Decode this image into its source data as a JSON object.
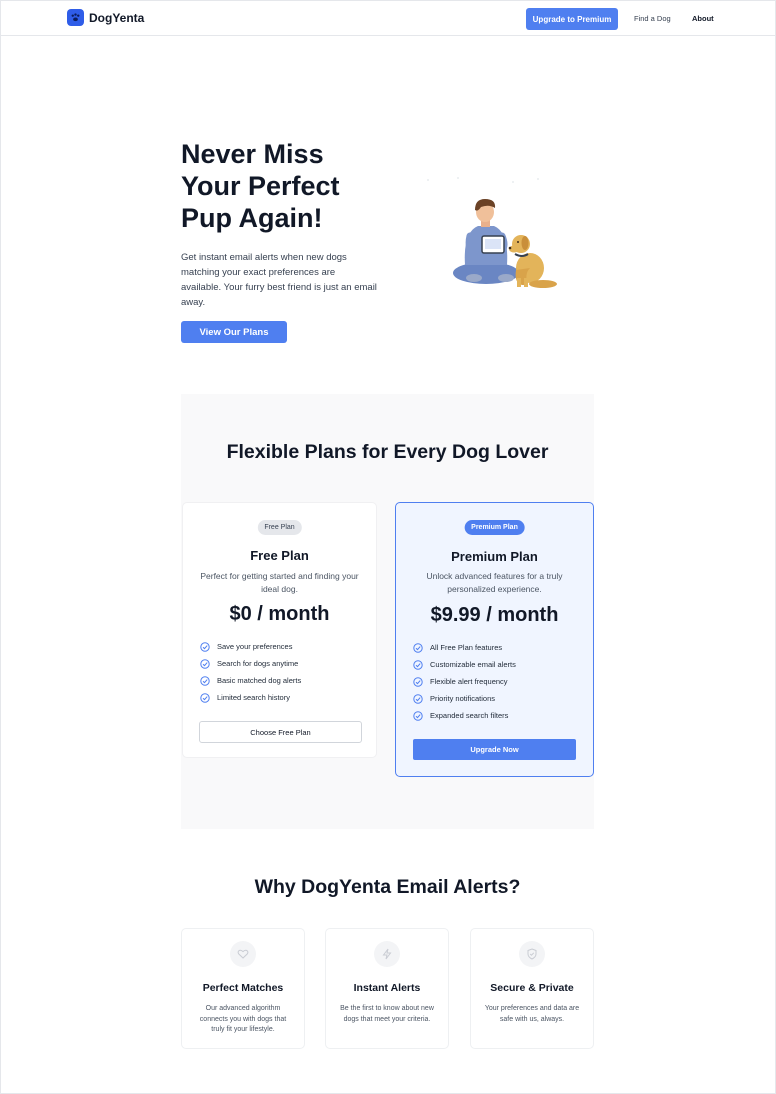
{
  "header": {
    "logo_text": "DogYenta",
    "upgrade_button": "Upgrade to Premium",
    "nav": {
      "find": "Find a Dog",
      "about": "About"
    }
  },
  "hero": {
    "title": "Never Miss Your Perfect Pup Again!",
    "description": "Get instant email alerts when new dogs matching your exact preferences are available. Your furry best friend is just an email away.",
    "cta": "View Our Plans"
  },
  "plans": {
    "heading": "Flexible Plans for Every Dog Lover",
    "free": {
      "pill": "Free Plan",
      "title": "Free Plan",
      "description": "Perfect for getting started and finding your ideal dog.",
      "price": "$0 / month",
      "features": [
        "Save your preferences",
        "Search for dogs anytime",
        "Basic matched dog alerts",
        "Limited search history"
      ],
      "button": "Choose Free Plan"
    },
    "premium": {
      "pill": "Premium Plan",
      "title": "Premium Plan",
      "description": "Unlock advanced features for a truly personalized experience.",
      "price": "$9.99 / month",
      "features": [
        "All Free Plan features",
        "Customizable email alerts",
        "Flexible alert frequency",
        "Priority notifications",
        "Expanded search filters"
      ],
      "button": "Upgrade Now"
    }
  },
  "why": {
    "heading": "Why DogYenta Email Alerts?",
    "cards": [
      {
        "icon": "heart-icon",
        "title": "Perfect Matches",
        "text": "Our advanced algorithm connects you with dogs that truly fit your lifestyle."
      },
      {
        "icon": "lightning-icon",
        "title": "Instant Alerts",
        "text": "Be the first to know about new dogs that meet your criteria."
      },
      {
        "icon": "shield-icon",
        "title": "Secure & Private",
        "text": "Your preferences and data are safe with us, always."
      }
    ]
  },
  "colors": {
    "accent": "#4f7ff0",
    "logo": "#2f5de8",
    "section_bg": "#f9f9fa",
    "premium_bg": "#f0f5ff"
  }
}
